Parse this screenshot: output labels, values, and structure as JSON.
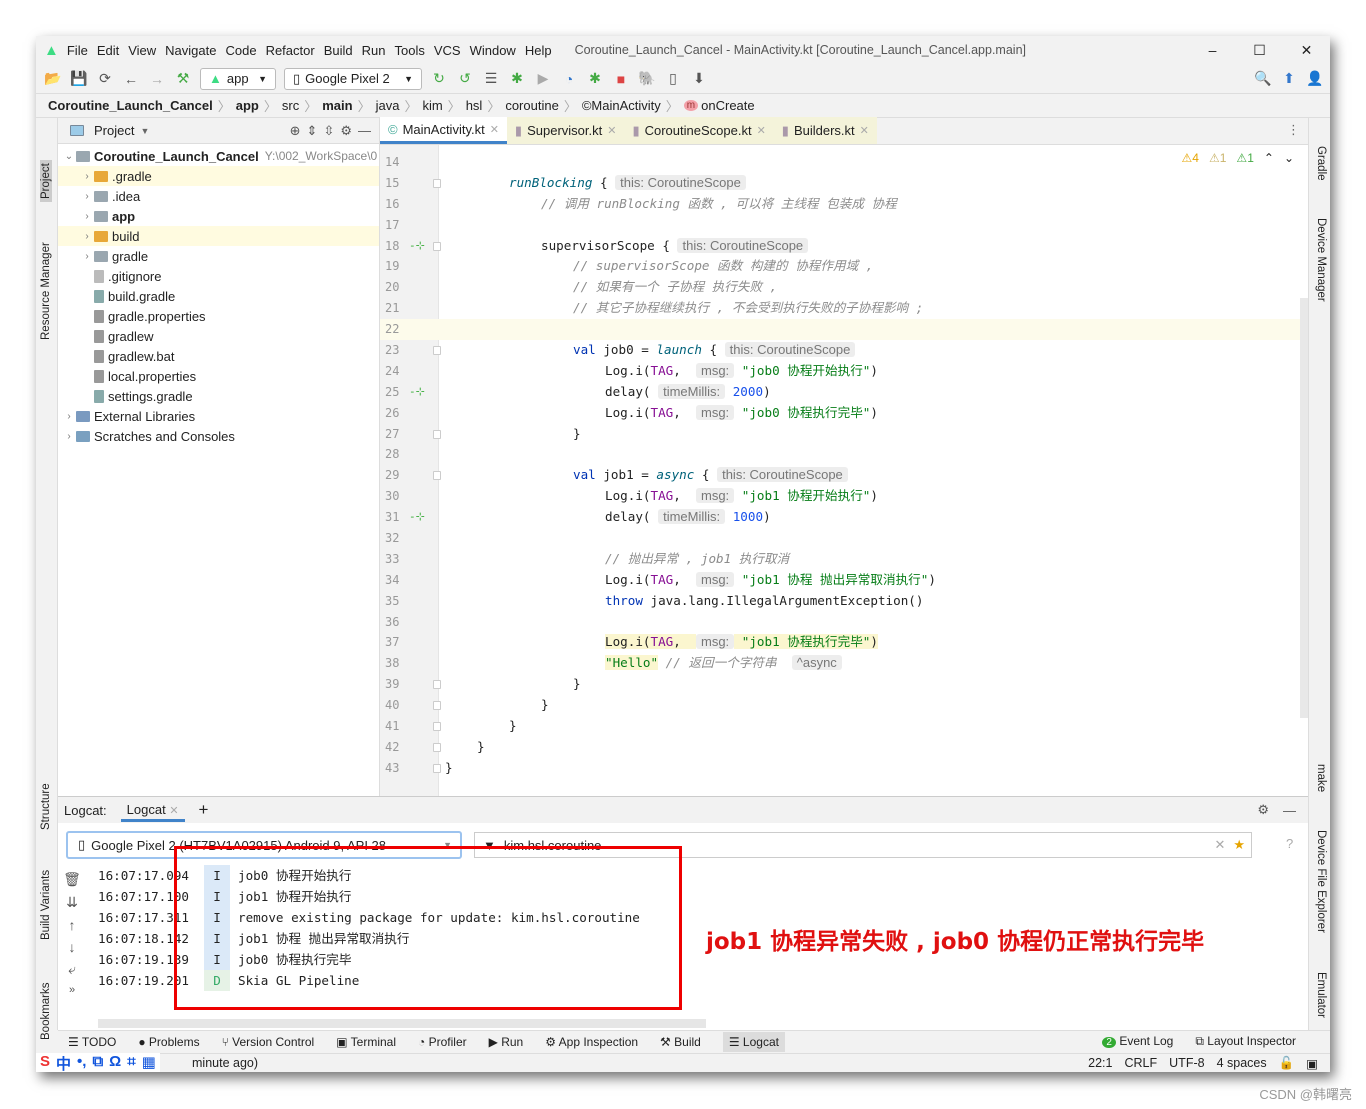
{
  "window": {
    "title": "Coroutine_Launch_Cancel - MainActivity.kt [Coroutine_Launch_Cancel.app.main]",
    "controls": [
      "–",
      "☐",
      "✕"
    ]
  },
  "menu": [
    "File",
    "Edit",
    "View",
    "Navigate",
    "Code",
    "Refactor",
    "Build",
    "Run",
    "Tools",
    "VCS",
    "Window",
    "Help"
  ],
  "toolbar": {
    "config": "app",
    "device": "Google Pixel 2"
  },
  "breadcrumb": [
    {
      "t": "Coroutine_Launch_Cancel",
      "b": true
    },
    {
      "t": "app",
      "b": true
    },
    {
      "t": "src"
    },
    {
      "t": "main",
      "b": true
    },
    {
      "t": "java"
    },
    {
      "t": "kim"
    },
    {
      "t": "hsl"
    },
    {
      "t": "coroutine"
    },
    {
      "t": "MainActivity"
    },
    {
      "t": "onCreate"
    }
  ],
  "left_stripe": [
    "Project",
    "Resource Manager",
    "Structure",
    "Build Variants",
    "Bookmarks"
  ],
  "right_stripe": [
    "Gradle",
    "Device Manager",
    "make",
    "Device File Explorer",
    "Emulator"
  ],
  "project": {
    "header": "Project",
    "root": "Coroutine_Launch_Cancel",
    "root_path": "Y:\\002_WorkSpace\\0",
    "items": [
      {
        "label": ".gradle",
        "arrow": true,
        "color": "#e8a838",
        "indent": 1,
        "sel": true
      },
      {
        "label": ".idea",
        "arrow": true,
        "color": "#9aa7b0",
        "indent": 1
      },
      {
        "label": "app",
        "arrow": true,
        "color": "#9aa7b0",
        "indent": 1,
        "bold": true
      },
      {
        "label": "build",
        "arrow": true,
        "color": "#e8a838",
        "indent": 1,
        "sel": true
      },
      {
        "label": "gradle",
        "arrow": true,
        "color": "#9aa7b0",
        "indent": 1
      },
      {
        "label": ".gitignore",
        "color": "#bbb",
        "indent": 1
      },
      {
        "label": "build.gradle",
        "color": "#8aa",
        "indent": 1
      },
      {
        "label": "gradle.properties",
        "color": "#999",
        "indent": 1
      },
      {
        "label": "gradlew",
        "color": "#999",
        "indent": 1
      },
      {
        "label": "gradlew.bat",
        "color": "#999",
        "indent": 1
      },
      {
        "label": "local.properties",
        "color": "#999",
        "indent": 1
      },
      {
        "label": "settings.gradle",
        "color": "#8aa",
        "indent": 1
      },
      {
        "label": "External Libraries",
        "arrow": true,
        "color": "#7a9ac0",
        "indent": 0
      },
      {
        "label": "Scratches and Consoles",
        "arrow": true,
        "color": "#7aa0c0",
        "indent": 0
      }
    ]
  },
  "editor": {
    "tabs": [
      {
        "label": "MainActivity.kt",
        "active": true
      },
      {
        "label": "Supervisor.kt",
        "mod": true
      },
      {
        "label": "CoroutineScope.kt",
        "mod": true
      },
      {
        "label": "Builders.kt",
        "mod": true
      }
    ],
    "inspections": {
      "warnings": "4",
      "weak": "1",
      "ok": "1"
    },
    "lines": [
      {
        "n": "14",
        "tk": []
      },
      {
        "n": "15",
        "ind": 2,
        "fold": true,
        "tk": [
          {
            "c": "fn",
            "t": "runBlocking"
          },
          {
            "t": " { "
          },
          {
            "c": "hint",
            "t": "this: CoroutineScope"
          }
        ]
      },
      {
        "n": "16",
        "ind": 3,
        "tk": [
          {
            "c": "cm",
            "t": "// 调用 runBlocking 函数 , 可以将 主线程 包装成 协程"
          }
        ]
      },
      {
        "n": "17",
        "tk": []
      },
      {
        "n": "18",
        "ind": 3,
        "mark": true,
        "fold": true,
        "tk": [
          {
            "t": "supervisorScope { "
          },
          {
            "c": "hint",
            "t": "this: CoroutineScope"
          }
        ]
      },
      {
        "n": "19",
        "ind": 4,
        "tk": [
          {
            "c": "cm",
            "t": "// supervisorScope 函数 构建的 协程作用域 ,"
          }
        ]
      },
      {
        "n": "20",
        "ind": 4,
        "tk": [
          {
            "c": "cm",
            "t": "// 如果有一个 子协程 执行失败 ,"
          }
        ]
      },
      {
        "n": "21",
        "ind": 4,
        "tk": [
          {
            "c": "cm",
            "t": "// 其它子协程继续执行 , 不会受到执行失败的子协程影响 ;"
          }
        ]
      },
      {
        "n": "22",
        "cur": true,
        "tk": []
      },
      {
        "n": "23",
        "ind": 4,
        "fold": true,
        "tk": [
          {
            "c": "kw",
            "t": "val"
          },
          {
            "t": " job0 = "
          },
          {
            "c": "fn",
            "t": "launch"
          },
          {
            "t": " { "
          },
          {
            "c": "hint",
            "t": "this: CoroutineScope"
          }
        ]
      },
      {
        "n": "24",
        "ind": 5,
        "tk": [
          {
            "t": "Log.i("
          },
          {
            "c": "cst",
            "t": "TAG"
          },
          {
            "t": ",  "
          },
          {
            "c": "hint",
            "t": "msg:"
          },
          {
            "c": "str",
            "t": " \"job0 协程开始执行\""
          },
          {
            "t": ")"
          }
        ]
      },
      {
        "n": "25",
        "ind": 5,
        "mark": true,
        "tk": [
          {
            "t": "delay( "
          },
          {
            "c": "hint",
            "t": "timeMillis:"
          },
          {
            "c": "num",
            "t": " 2000"
          },
          {
            "t": ")"
          }
        ]
      },
      {
        "n": "26",
        "ind": 5,
        "tk": [
          {
            "t": "Log.i("
          },
          {
            "c": "cst",
            "t": "TAG"
          },
          {
            "t": ",  "
          },
          {
            "c": "hint",
            "t": "msg:"
          },
          {
            "c": "str",
            "t": " \"job0 协程执行完毕\""
          },
          {
            "t": ")"
          }
        ]
      },
      {
        "n": "27",
        "ind": 4,
        "fold": true,
        "tk": [
          {
            "t": "}"
          }
        ]
      },
      {
        "n": "28",
        "tk": []
      },
      {
        "n": "29",
        "ind": 4,
        "fold": true,
        "tk": [
          {
            "c": "kw",
            "t": "val"
          },
          {
            "t": " job1 = "
          },
          {
            "c": "fn",
            "t": "async"
          },
          {
            "t": " { "
          },
          {
            "c": "hint",
            "t": "this: CoroutineScope"
          }
        ]
      },
      {
        "n": "30",
        "ind": 5,
        "tk": [
          {
            "t": "Log.i("
          },
          {
            "c": "cst",
            "t": "TAG"
          },
          {
            "t": ",  "
          },
          {
            "c": "hint",
            "t": "msg:"
          },
          {
            "c": "str",
            "t": " \"job1 协程开始执行\""
          },
          {
            "t": ")"
          }
        ]
      },
      {
        "n": "31",
        "ind": 5,
        "mark": true,
        "tk": [
          {
            "t": "delay( "
          },
          {
            "c": "hint",
            "t": "timeMillis:"
          },
          {
            "c": "num",
            "t": " 1000"
          },
          {
            "t": ")"
          }
        ]
      },
      {
        "n": "32",
        "tk": []
      },
      {
        "n": "33",
        "ind": 5,
        "tk": [
          {
            "c": "cm",
            "t": "// 抛出异常 , job1 执行取消"
          }
        ]
      },
      {
        "n": "34",
        "ind": 5,
        "tk": [
          {
            "t": "Log.i("
          },
          {
            "c": "cst",
            "t": "TAG"
          },
          {
            "t": ",  "
          },
          {
            "c": "hint",
            "t": "msg:"
          },
          {
            "c": "str",
            "t": " \"job1 协程 抛出异常取消执行\""
          },
          {
            "t": ")"
          }
        ]
      },
      {
        "n": "35",
        "ind": 5,
        "tk": [
          {
            "c": "kw",
            "t": "throw"
          },
          {
            "t": " java.lang.IllegalArgumentException()"
          }
        ]
      },
      {
        "n": "36",
        "tk": []
      },
      {
        "n": "37",
        "ind": 5,
        "tk": [
          {
            "c": "hl",
            "t": "Log.i("
          },
          {
            "c": "cst hl",
            "t": "TAG"
          },
          {
            "c": "hl",
            "t": ",  "
          },
          {
            "c": "hint",
            "t": "msg:"
          },
          {
            "c": "str hl",
            "t": " \"job1 协程执行完毕\""
          },
          {
            "c": "hl",
            "t": ")"
          }
        ]
      },
      {
        "n": "38",
        "ind": 5,
        "tk": [
          {
            "c": "str hl",
            "t": "\"Hello\""
          },
          {
            "t": " "
          },
          {
            "c": "cm",
            "t": "// 返回一个字符串"
          },
          {
            "t": "  "
          },
          {
            "c": "hint",
            "t": "^async"
          }
        ]
      },
      {
        "n": "39",
        "ind": 4,
        "fold": true,
        "tk": [
          {
            "t": "}"
          }
        ]
      },
      {
        "n": "40",
        "ind": 3,
        "fold": true,
        "tk": [
          {
            "t": "}"
          }
        ]
      },
      {
        "n": "41",
        "ind": 2,
        "fold": true,
        "tk": [
          {
            "t": "}"
          }
        ]
      },
      {
        "n": "42",
        "ind": 1,
        "fold": true,
        "tk": [
          {
            "t": "}"
          }
        ]
      },
      {
        "n": "43",
        "ind": 0,
        "fold": true,
        "tk": [
          {
            "t": "}"
          }
        ]
      }
    ]
  },
  "logcat": {
    "label": "Logcat:",
    "tab": "Logcat",
    "add": "+",
    "device": "Google Pixel 2 (HT7BV1A02915) Android 9, API 28",
    "filter": "kim.hsl.coroutine",
    "rows": [
      {
        "ts": "16:07:17.094",
        "lv": "I",
        "msg": "job0 协程开始执行"
      },
      {
        "ts": "16:07:17.100",
        "lv": "I",
        "msg": "job1 协程开始执行"
      },
      {
        "ts": "16:07:17.311",
        "lv": "I",
        "msg": "remove existing package for update: kim.hsl.coroutine"
      },
      {
        "ts": "16:07:18.142",
        "lv": "I",
        "msg": "job1 协程 抛出异常取消执行"
      },
      {
        "ts": "16:07:19.139",
        "lv": "I",
        "msg": "job0 协程执行完毕"
      },
      {
        "ts": "16:07:19.201",
        "lv": "D",
        "msg": "Skia GL Pipeline"
      }
    ]
  },
  "annotation": "job1 协程异常失败 , job0 协程仍正常执行完毕",
  "bottom_tools": [
    "TODO",
    "Problems",
    "Version Control",
    "Terminal",
    "Profiler",
    "Run",
    "App Inspection",
    "Build",
    "Logcat"
  ],
  "bottom_right": {
    "event_log": "Event Log",
    "event_count": "2",
    "layout_inspector": "Layout Inspector"
  },
  "status": {
    "message": "minute ago)",
    "position": "22:1",
    "line_sep": "CRLF",
    "encoding": "UTF-8",
    "indent": "4 spaces"
  },
  "ime": [
    "S",
    "中",
    "•,",
    "⧉",
    "Ω",
    "⌗",
    "▦"
  ],
  "watermark": "CSDN @韩曙亮"
}
